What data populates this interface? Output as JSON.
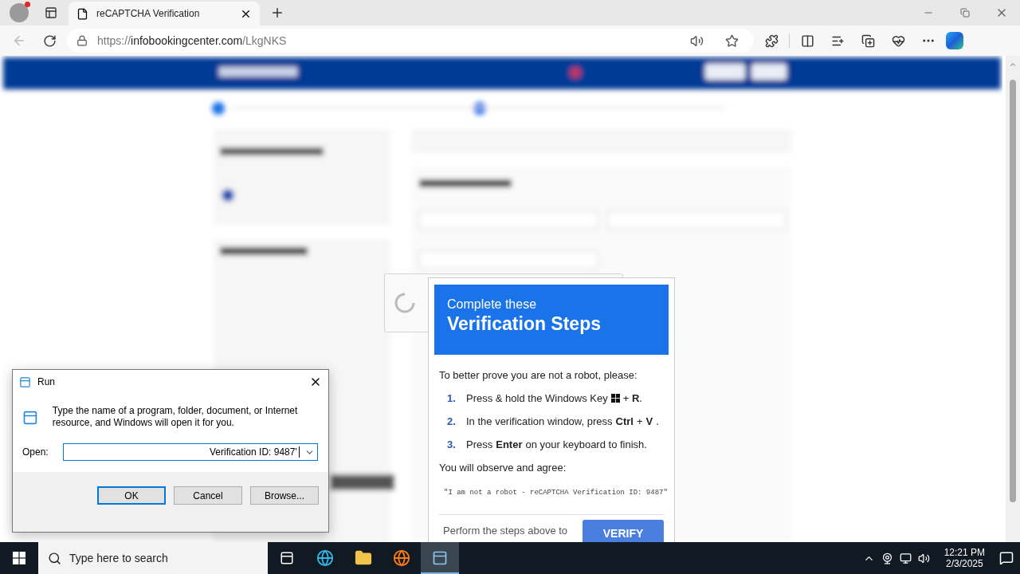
{
  "browser": {
    "tab": {
      "title": "reCAPTCHA Verification",
      "selected": true
    },
    "url": {
      "scheme": "https://",
      "host": "infobookingcenter.com",
      "path": "/LkgNKS"
    }
  },
  "captcha_box": {
    "loading": true
  },
  "verification_popup": {
    "subtitle": "Complete these",
    "title": "Verification Steps",
    "intro": "To better prove you are not a robot, please:",
    "steps": [
      {
        "number": "1.",
        "text": "Press & hold the Windows Key",
        "text_after_icon": "+ **R**."
      },
      {
        "number": "2.",
        "text": "In the verification window, press **Ctrl** + **V**."
      },
      {
        "number": "3.",
        "text": "Press **Enter** on your keyboard to finish."
      }
    ],
    "observe": "You will observe and agree:",
    "quote": "\"I am not a robot - reCAPTCHA Verification ID: 9487\"",
    "footer_text": "Perform the steps above to",
    "verify_button": "VERIFY"
  },
  "run_dialog": {
    "title": "Run",
    "description": "Type the name of a program, folder, document, or Internet resource, and Windows will open it for you.",
    "open_label": "Open:",
    "value": "Verification ID: 9487'",
    "buttons": [
      {
        "label": "OK",
        "selected": true
      },
      {
        "label": "Cancel",
        "selected": false
      },
      {
        "label": "Browse...",
        "selected": false
      }
    ]
  },
  "taskbar": {
    "search_placeholder": "Type here to search",
    "apps": [
      {
        "kind": "taskview",
        "selected": false
      },
      {
        "kind": "edge",
        "selected": false
      },
      {
        "kind": "explorer",
        "selected": false
      },
      {
        "kind": "firefox",
        "selected": false
      },
      {
        "kind": "run",
        "selected": true
      }
    ],
    "time": "12:21 PM",
    "date": "2/3/2025"
  }
}
